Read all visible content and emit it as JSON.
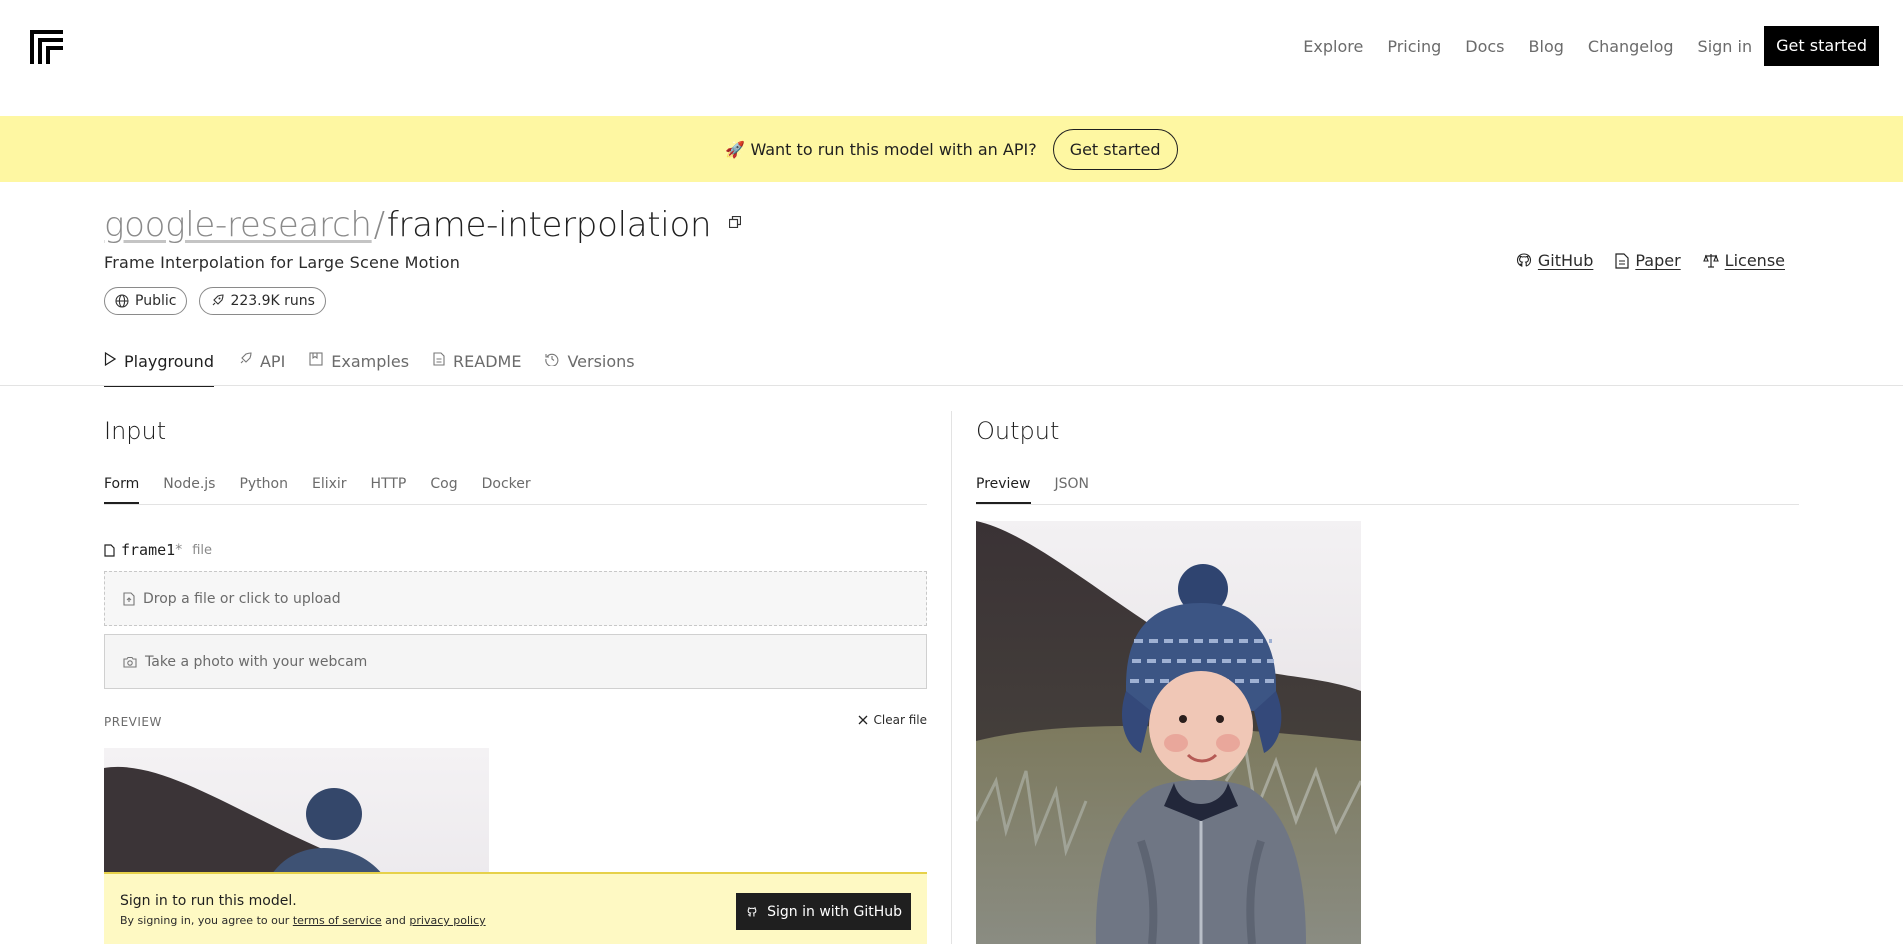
{
  "nav": {
    "links": [
      "Explore",
      "Pricing",
      "Docs",
      "Blog",
      "Changelog",
      "Sign in"
    ],
    "cta": "Get started"
  },
  "banner": {
    "emoji": "🚀",
    "text": "Want to run this model with an API?",
    "button": "Get started"
  },
  "model": {
    "owner": "google-research",
    "separator": "/",
    "name": "frame-interpolation",
    "description": "Frame Interpolation for Large Scene Motion",
    "visibility": "Public",
    "runs": "223.9K runs",
    "links": {
      "github": "GitHub",
      "paper": "Paper",
      "license": "License"
    }
  },
  "tabs": [
    "Playground",
    "API",
    "Examples",
    "README",
    "Versions"
  ],
  "input": {
    "title": "Input",
    "subtabs": [
      "Form",
      "Node.js",
      "Python",
      "Elixir",
      "HTTP",
      "Cog",
      "Docker"
    ],
    "field_name": "frame1",
    "field_required": "*",
    "field_type": "file",
    "dropzone": "Drop a file or click to upload",
    "webcam": "Take a photo with your webcam",
    "preview_label": "PREVIEW",
    "clear_file": "Clear file"
  },
  "output": {
    "title": "Output",
    "subtabs": [
      "Preview",
      "JSON"
    ]
  },
  "signin": {
    "title": "Sign in to run this model.",
    "sub_prefix": "By signing in, you agree to our ",
    "terms": "terms of service",
    "and": " and ",
    "privacy": "privacy policy",
    "button": "Sign in with GitHub"
  },
  "icons": {
    "logo": "replicate-logo",
    "rocket": "rocket-icon",
    "globe": "globe-icon",
    "github": "github-icon",
    "paper": "document-icon",
    "license": "scale-icon",
    "copy": "copy-icon"
  },
  "colors": {
    "banner_bg": "#fef7a2",
    "signin_bg": "#fef9c3",
    "cta_bg": "#000000"
  }
}
